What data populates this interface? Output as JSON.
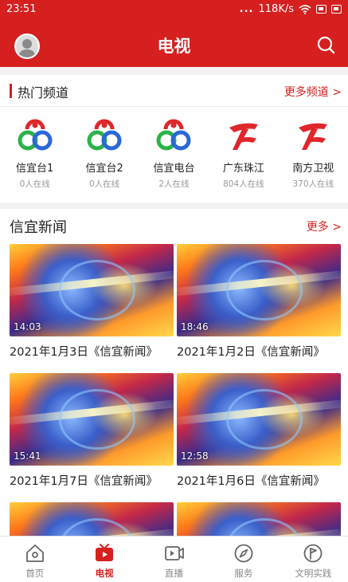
{
  "status": {
    "time": "23:51",
    "dots": "...",
    "speed": "118K/s"
  },
  "header": {
    "title": "电视"
  },
  "hot": {
    "title": "热门频道",
    "more": "更多频道 >",
    "channels": [
      {
        "name": "信宜台1",
        "online": "0人在线",
        "logo": "xinyi-logo-icon"
      },
      {
        "name": "信宜台2",
        "online": "0人在线",
        "logo": "xinyi-logo-icon"
      },
      {
        "name": "信宜电台",
        "online": "2人在线",
        "logo": "xinyi-logo-icon"
      },
      {
        "name": "广东珠江",
        "online": "804人在线",
        "logo": "gdtv-logo-icon"
      },
      {
        "name": "南方卫视",
        "online": "370人在线",
        "logo": "gdtv-logo-icon"
      }
    ]
  },
  "news": {
    "title": "信宜新闻",
    "more": "更多 >",
    "items": [
      {
        "duration": "14:03",
        "title": "2021年1月3日《信宜新闻》"
      },
      {
        "duration": "18:46",
        "title": "2021年1月2日《信宜新闻》"
      },
      {
        "duration": "15:41",
        "title": "2021年1月7日《信宜新闻》"
      },
      {
        "duration": "12:58",
        "title": "2021年1月6日《信宜新闻》"
      },
      {
        "duration": "",
        "title": ""
      },
      {
        "duration": "",
        "title": ""
      }
    ]
  },
  "tabs": [
    {
      "label": "首页",
      "icon": "home-icon",
      "active": false
    },
    {
      "label": "电视",
      "icon": "tv-icon",
      "active": true
    },
    {
      "label": "直播",
      "icon": "live-video-icon",
      "active": false
    },
    {
      "label": "服务",
      "icon": "compass-icon",
      "active": false
    },
    {
      "label": "文明实践",
      "icon": "flag-icon",
      "active": false
    }
  ],
  "colors": {
    "brand_red": "#d61f1f",
    "text_dark": "#222222",
    "text_grey": "#999999"
  }
}
